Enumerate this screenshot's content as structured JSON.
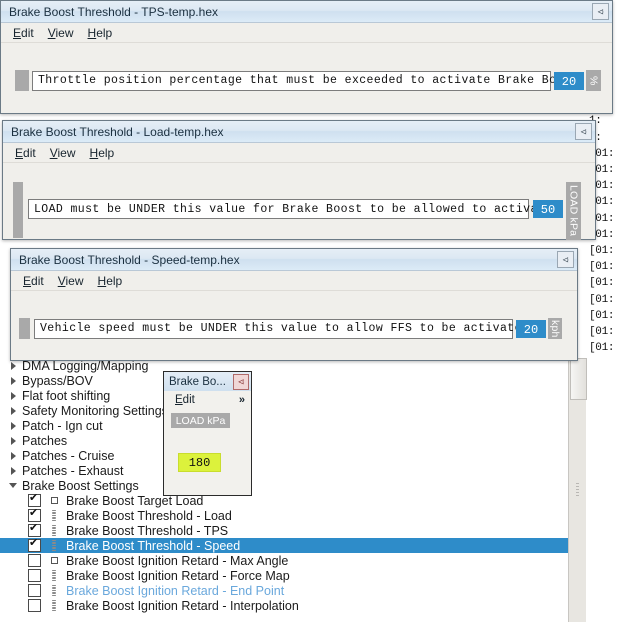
{
  "background": {
    "log_line_left": "1:",
    "log_line": "[01:",
    "line_count": 31
  },
  "windows": [
    {
      "id": "tps",
      "title": "Brake Boost Threshold - TPS-temp.hex",
      "menus": [
        "Edit",
        "View",
        "Help"
      ],
      "close_icon": "close-icon",
      "description": "Throttle position percentage that must be exceeded to activate Brake Boost:",
      "value": "20",
      "unit": "%"
    },
    {
      "id": "load",
      "title": "Brake Boost Threshold - Load-temp.hex",
      "menus": [
        "Edit",
        "View",
        "Help"
      ],
      "close_icon": "close-icon",
      "description": "LOAD must be UNDER this value for Brake Boost to be allowed to activate:",
      "value": "50",
      "unit": "LOAD kPa"
    },
    {
      "id": "speed",
      "title": "Brake Boost Threshold - Speed-temp.hex",
      "menus": [
        "Edit",
        "View",
        "Help"
      ],
      "close_icon": "close-icon",
      "description": "Vehicle speed must be UNDER this value to allow FFS to be activated:",
      "value": "20",
      "unit": "kph"
    }
  ],
  "mini_window": {
    "title": "Brake Bo...",
    "close_icon": "close-icon",
    "menu_label": "Edit",
    "overflow_chevron": "»",
    "column_header": "LOAD kPa",
    "value": "180"
  },
  "tree": {
    "groups": [
      {
        "label": "DMA Logging/Mapping",
        "expanded": false
      },
      {
        "label": "Bypass/BOV",
        "expanded": false
      },
      {
        "label": "Flat foot shifting",
        "expanded": false
      },
      {
        "label": "Safety Monitoring Settings",
        "expanded": false
      },
      {
        "label": "Patch - Ign cut",
        "expanded": false
      },
      {
        "label": "Patches",
        "expanded": false
      },
      {
        "label": "Patches - Cruise",
        "expanded": false
      },
      {
        "label": "Patches - Exhaust",
        "expanded": false
      },
      {
        "label": "Brake Boost Settings",
        "expanded": true
      }
    ],
    "items": [
      {
        "label": "Brake Boost Target Load",
        "checked": true,
        "selected": false,
        "icon": "single-value-icon",
        "link": false
      },
      {
        "label": "Brake Boost Threshold - Load",
        "checked": true,
        "selected": false,
        "icon": "map-table-icon",
        "link": false
      },
      {
        "label": "Brake Boost Threshold - TPS",
        "checked": true,
        "selected": false,
        "icon": "map-table-icon",
        "link": false
      },
      {
        "label": "Brake Boost Threshold - Speed",
        "checked": true,
        "selected": true,
        "icon": "map-table-icon",
        "link": false
      },
      {
        "label": "Brake Boost Ignition Retard - Max Angle",
        "checked": false,
        "selected": false,
        "icon": "single-value-icon",
        "link": false
      },
      {
        "label": "Brake Boost Ignition Retard - Force Map",
        "checked": false,
        "selected": false,
        "icon": "map-table-icon",
        "link": false
      },
      {
        "label": "Brake Boost Ignition Retard - End Point",
        "checked": false,
        "selected": false,
        "icon": "map-table-icon",
        "link": true
      },
      {
        "label": "Brake Boost Ignition Retard - Interpolation",
        "checked": false,
        "selected": false,
        "icon": "map-table-icon",
        "link": false
      }
    ]
  },
  "colors": {
    "selection_blue": "#2e8cc9",
    "value_blue": "#2e8cc9",
    "unit_gray": "#a9a9a9",
    "mini_value_yellow": "#dcf23c",
    "link_blue": "#6aa8dc"
  }
}
